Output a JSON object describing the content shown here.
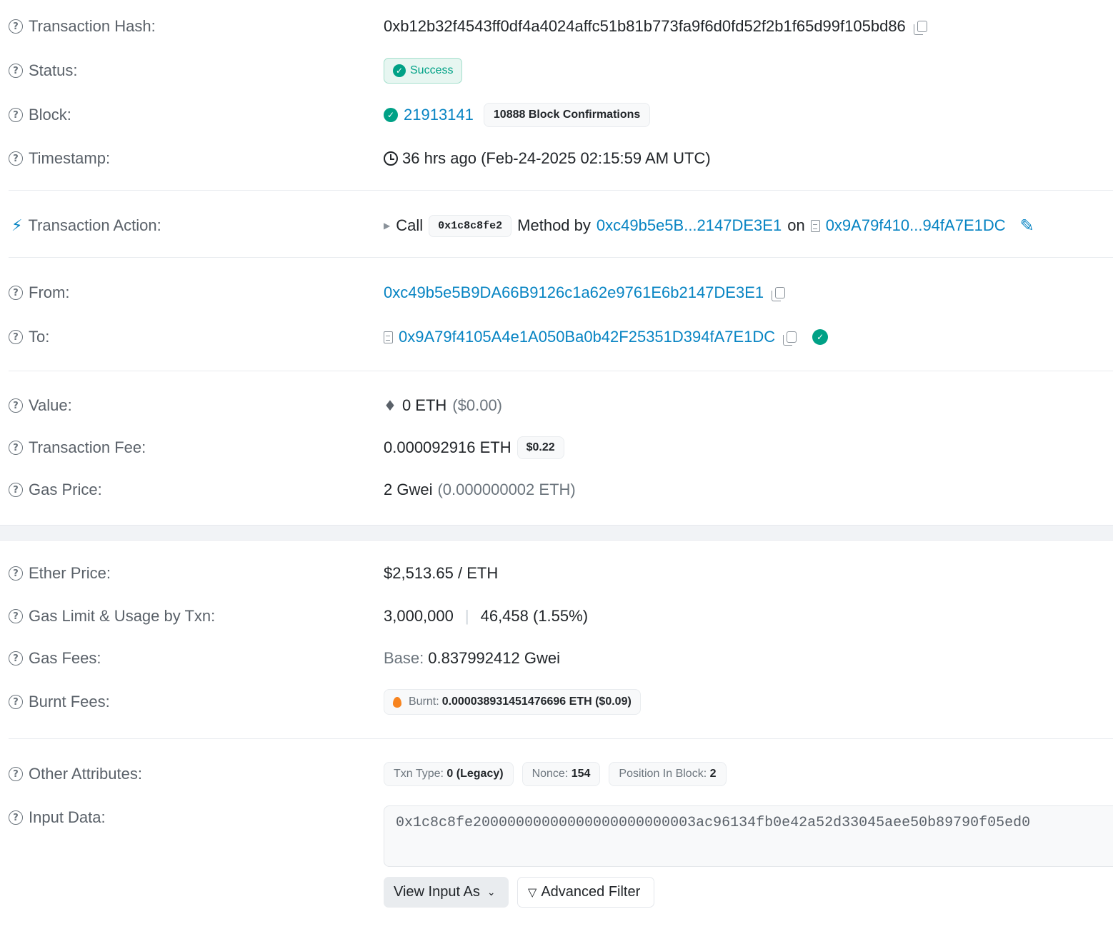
{
  "rows": {
    "hash": {
      "label": "Transaction Hash:",
      "value": "0xb12b32f4543ff0df4a4024affc51b81b773fa9f6d0fd52f2b1f65d99f105bd86"
    },
    "status": {
      "label": "Status:",
      "value": "Success"
    },
    "block": {
      "label": "Block:",
      "number": "21913141",
      "confirmations": "10888 Block Confirmations"
    },
    "timestamp": {
      "label": "Timestamp:",
      "value": "36 hrs ago (Feb-24-2025 02:15:59 AM UTC)"
    },
    "action": {
      "label": "Transaction Action:",
      "call": "Call",
      "method": "0x1c8c8fe2",
      "method_by": "Method by",
      "from": "0xc49b5e5B...2147DE3E1",
      "on": "on",
      "to": "0x9A79f410...94fA7E1DC"
    },
    "from": {
      "label": "From:",
      "value": "0xc49b5e5B9DA66B9126c1a62e9761E6b2147DE3E1"
    },
    "to": {
      "label": "To:",
      "value": "0x9A79f4105A4e1A050Ba0b42F25351D394fA7E1DC"
    },
    "value": {
      "label": "Value:",
      "eth": "0 ETH",
      "usd": "($0.00)"
    },
    "fee": {
      "label": "Transaction Fee:",
      "eth": "0.000092916 ETH",
      "usd": "$0.22"
    },
    "gas_price": {
      "label": "Gas Price:",
      "gwei": "2 Gwei",
      "eth": "(0.000000002 ETH)"
    },
    "ether_price": {
      "label": "Ether Price:",
      "value": "$2,513.65 / ETH"
    },
    "gas_limit": {
      "label": "Gas Limit & Usage by Txn:",
      "limit": "3,000,000",
      "sep": "|",
      "usage": "46,458 (1.55%)"
    },
    "gas_fees": {
      "label": "Gas Fees:",
      "base_label": "Base:",
      "base": "0.837992412 Gwei"
    },
    "burnt": {
      "label": "Burnt Fees:",
      "burnt_label": "Burnt:",
      "value": "0.000038931451476696 ETH ($0.09)"
    },
    "other": {
      "label": "Other Attributes:",
      "txn_type_label": "Txn Type:",
      "txn_type": "0 (Legacy)",
      "nonce_label": "Nonce:",
      "nonce": "154",
      "position_label": "Position In Block:",
      "position": "2"
    },
    "input": {
      "label": "Input Data:",
      "value": "0x1c8c8fe20000000000000000000000003ac96134fb0e42a52d33045aee50b89790f05ed0",
      "view_as": "View Input As",
      "advanced": "Advanced Filter"
    }
  },
  "colors": {
    "link": "#0784c3",
    "success": "#00a186",
    "muted": "#6c757d"
  }
}
